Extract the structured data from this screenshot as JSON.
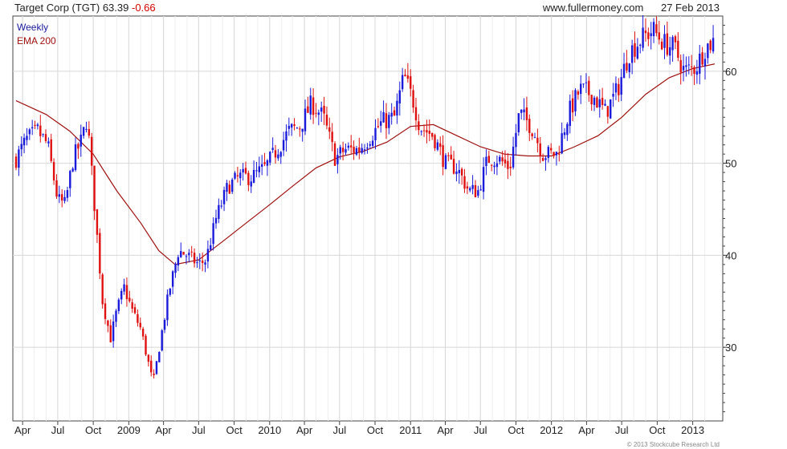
{
  "header": {
    "security": "Target Corp (TGT)",
    "last": "63.39",
    "change": "-0.66",
    "site": "www.fullermoney.com",
    "date": "27 Feb 2013"
  },
  "legend": {
    "period": "Weekly",
    "indicator": "EMA 200"
  },
  "footer": {
    "copyright": "© 2013 Stockcube Research Ltd"
  },
  "colors": {
    "up": "#1a1adc",
    "down": "#e01010",
    "ema": "#a01010",
    "grid": "#d8d8d8",
    "period_label": "#1a1aa0",
    "indicator_label": "#a01010"
  },
  "chart_data": {
    "type": "candlestick",
    "frequency": "weekly",
    "x_range": [
      "2008-03-15",
      "2013-02-27"
    ],
    "ylim": [
      22,
      66
    ],
    "y_ticks": [
      30,
      40,
      50,
      60
    ],
    "x_ticks": [
      {
        "label": "Apr",
        "date": "2008-04-01"
      },
      {
        "label": "Jul",
        "date": "2008-07-01"
      },
      {
        "label": "Oct",
        "date": "2008-10-01"
      },
      {
        "label": "2009",
        "date": "2009-01-01"
      },
      {
        "label": "Apr",
        "date": "2009-04-01"
      },
      {
        "label": "Jul",
        "date": "2009-07-01"
      },
      {
        "label": "Oct",
        "date": "2009-10-01"
      },
      {
        "label": "2010",
        "date": "2010-01-01"
      },
      {
        "label": "Apr",
        "date": "2010-04-01"
      },
      {
        "label": "Jul",
        "date": "2010-07-01"
      },
      {
        "label": "Oct",
        "date": "2010-10-01"
      },
      {
        "label": "2011",
        "date": "2011-01-01"
      },
      {
        "label": "Apr",
        "date": "2011-04-01"
      },
      {
        "label": "Jul",
        "date": "2011-07-01"
      },
      {
        "label": "Oct",
        "date": "2011-10-01"
      },
      {
        "label": "2012",
        "date": "2012-01-01"
      },
      {
        "label": "Apr",
        "date": "2012-04-01"
      },
      {
        "label": "Jul",
        "date": "2012-07-01"
      },
      {
        "label": "Oct",
        "date": "2012-10-01"
      },
      {
        "label": "2013",
        "date": "2013-01-01"
      }
    ],
    "grid": true,
    "close_path": [
      [
        "2008-03-15",
        50.5
      ],
      [
        "2008-04-10",
        52.5
      ],
      [
        "2008-05-10",
        53.5
      ],
      [
        "2008-06-05",
        52.0
      ],
      [
        "2008-07-01",
        46.0
      ],
      [
        "2008-07-20",
        45.5
      ],
      [
        "2008-08-10",
        50.5
      ],
      [
        "2008-09-01",
        52.5
      ],
      [
        "2008-09-15",
        55.0
      ],
      [
        "2008-10-05",
        45.0
      ],
      [
        "2008-10-25",
        35.0
      ],
      [
        "2008-11-15",
        31.0
      ],
      [
        "2008-12-01",
        34.0
      ],
      [
        "2008-12-20",
        36.5
      ],
      [
        "2009-01-10",
        34.0
      ],
      [
        "2009-02-01",
        32.0
      ],
      [
        "2009-03-05",
        26.0
      ],
      [
        "2009-03-25",
        31.0
      ],
      [
        "2009-04-15",
        36.0
      ],
      [
        "2009-05-10",
        40.5
      ],
      [
        "2009-06-01",
        40.0
      ],
      [
        "2009-07-01",
        39.0
      ],
      [
        "2009-07-20",
        39.5
      ],
      [
        "2009-08-15",
        44.0
      ],
      [
        "2009-09-15",
        47.5
      ],
      [
        "2009-10-15",
        48.5
      ],
      [
        "2009-11-15",
        48.5
      ],
      [
        "2009-12-20",
        49.5
      ],
      [
        "2010-01-20",
        51.5
      ],
      [
        "2010-02-20",
        53.5
      ],
      [
        "2010-03-20",
        54.0
      ],
      [
        "2010-04-20",
        56.5
      ],
      [
        "2010-05-20",
        55.0
      ],
      [
        "2010-06-20",
        50.5
      ],
      [
        "2010-07-15",
        51.5
      ],
      [
        "2010-08-20",
        51.5
      ],
      [
        "2010-09-20",
        53.0
      ],
      [
        "2010-10-20",
        54.5
      ],
      [
        "2010-11-20",
        55.0
      ],
      [
        "2010-12-15",
        59.5
      ],
      [
        "2011-01-10",
        56.5
      ],
      [
        "2011-01-25",
        54.0
      ],
      [
        "2011-03-01",
        53.0
      ],
      [
        "2011-04-01",
        50.0
      ],
      [
        "2011-05-01",
        49.5
      ],
      [
        "2011-06-01",
        47.0
      ],
      [
        "2011-06-25",
        47.0
      ],
      [
        "2011-07-20",
        50.5
      ],
      [
        "2011-08-15",
        50.5
      ],
      [
        "2011-09-15",
        49.5
      ],
      [
        "2011-10-10",
        55.5
      ],
      [
        "2011-11-10",
        54.0
      ],
      [
        "2011-12-10",
        51.0
      ],
      [
        "2012-01-15",
        51.0
      ],
      [
        "2012-02-15",
        55.5
      ],
      [
        "2012-03-15",
        58.0
      ],
      [
        "2012-04-15",
        57.5
      ],
      [
        "2012-05-20",
        55.5
      ],
      [
        "2012-06-20",
        58.0
      ],
      [
        "2012-07-20",
        62.0
      ],
      [
        "2012-08-20",
        63.5
      ],
      [
        "2012-09-20",
        64.5
      ],
      [
        "2012-10-20",
        63.0
      ],
      [
        "2012-11-15",
        62.5
      ],
      [
        "2012-12-10",
        60.0
      ],
      [
        "2013-01-10",
        60.5
      ],
      [
        "2013-02-01",
        62.5
      ],
      [
        "2013-02-27",
        63.4
      ]
    ],
    "ema_200": [
      [
        "2008-03-15",
        56.8
      ],
      [
        "2008-06-01",
        55.3
      ],
      [
        "2008-08-01",
        53.5
      ],
      [
        "2008-10-01",
        51.0
      ],
      [
        "2008-12-01",
        47.0
      ],
      [
        "2009-02-01",
        43.5
      ],
      [
        "2009-03-20",
        40.5
      ],
      [
        "2009-05-01",
        39.0
      ],
      [
        "2009-07-01",
        39.5
      ],
      [
        "2009-09-01",
        41.5
      ],
      [
        "2009-11-01",
        43.5
      ],
      [
        "2010-01-01",
        45.5
      ],
      [
        "2010-03-01",
        47.5
      ],
      [
        "2010-05-01",
        49.5
      ],
      [
        "2010-07-01",
        50.7
      ],
      [
        "2010-09-01",
        51.3
      ],
      [
        "2010-11-01",
        52.3
      ],
      [
        "2011-01-01",
        54.0
      ],
      [
        "2011-03-01",
        54.2
      ],
      [
        "2011-05-01",
        53.0
      ],
      [
        "2011-07-01",
        51.8
      ],
      [
        "2011-09-01",
        51.0
      ],
      [
        "2011-11-01",
        50.8
      ],
      [
        "2012-01-01",
        50.8
      ],
      [
        "2012-03-01",
        51.8
      ],
      [
        "2012-05-01",
        53.0
      ],
      [
        "2012-07-01",
        55.0
      ],
      [
        "2012-09-01",
        57.5
      ],
      [
        "2012-11-01",
        59.3
      ],
      [
        "2013-01-01",
        60.3
      ],
      [
        "2013-02-27",
        60.8
      ]
    ]
  }
}
